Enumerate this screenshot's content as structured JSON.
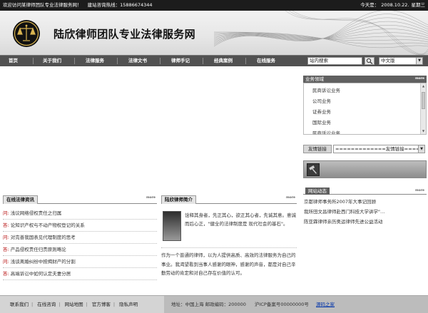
{
  "topbar": {
    "welcome": "欢迎访问某律师团队专业法律服务网！",
    "hotline_label": "建站咨询热线：",
    "hotline_number": "15886674344",
    "date_label": "今天是：",
    "date": "2008.10.22.",
    "weekday": "星期三"
  },
  "banner": {
    "logo": "scales-of-justice-icon",
    "title": "陆欣律师团队专业法律服务网"
  },
  "nav": {
    "items": [
      "首页",
      "关于我们",
      "法律服务",
      "法律文书",
      "律师手记",
      "经典案例",
      "在线服务"
    ],
    "search_value": "站内搜索",
    "search_button_icon": "magnifier-icon",
    "language": "中文版"
  },
  "practice": {
    "title": "业务领域",
    "more": "more",
    "items": [
      "民商诉讼业务",
      "公司业务",
      "证券业务",
      "国际业务",
      "民商诉讼业务"
    ]
  },
  "friend_links": {
    "label": "友情链接",
    "select_value": "=============友情链接============"
  },
  "news": {
    "title": "网站动态",
    "more": "more",
    "items": [
      "京都律师事务所2007年大事记回顾",
      "我所田文昌律师赴西门科技大学讲学\"…",
      "陈亚霖律师亲历奥运律师先进公益活动"
    ]
  },
  "consult": {
    "title": "在线法律资讯",
    "more": "more",
    "q_prefix": "问:",
    "a_prefix": "答:",
    "items": [
      {
        "prefix": "问:",
        "text": "浅议网络侵权责任之归属"
      },
      {
        "prefix": "答:",
        "text": "论知识产权与不动产物权登记的关系"
      },
      {
        "prefix": "问:",
        "text": "对完善我国表见代理制度的思考"
      },
      {
        "prefix": "答:",
        "text": "产品侵权责任归责原则略论"
      },
      {
        "prefix": "问:",
        "text": "浅谈离婚纠纷中按揭财产的分割"
      },
      {
        "prefix": "答:",
        "text": "高端诉讼中如何认定夫妻分居"
      }
    ]
  },
  "intro": {
    "title": "陆欣律师简介",
    "more": "more",
    "text1": "诠释其身者，先正其心，欲正其心者，先诚其意。意诚而后心正，\"健全的法律制度是 现代社会的基石\"。",
    "text2": "作为一个普通的律师，以为人提供高质、高效的法律服务为自己的事业。我渴望看到当事人感谢的眼神，感谢的声音，都是对自己辛勤劳动的肯定和对自己存在价值的认可。"
  },
  "footer": {
    "links": [
      "联系我们",
      "在线咨询",
      "网站地图",
      "官方博客",
      "隐私声明"
    ],
    "address": "地址：中国上海  邮政编码：200000",
    "icp": "沪ICP备案号00000000号",
    "credit": "源码之家"
  }
}
